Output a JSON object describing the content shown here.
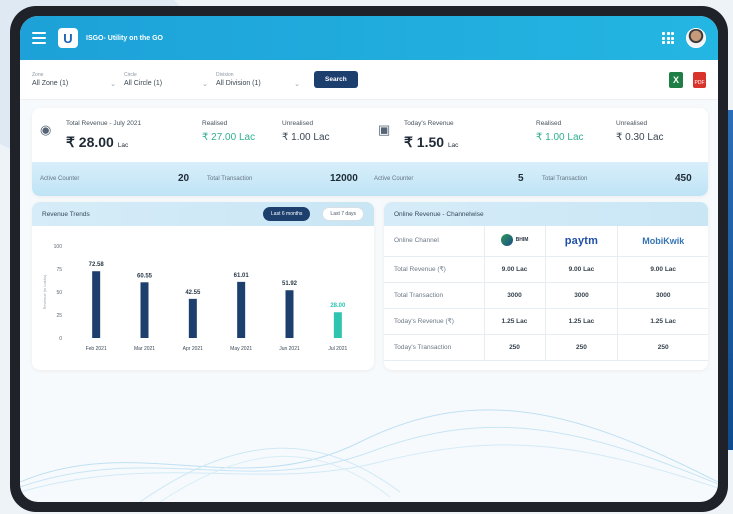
{
  "app": {
    "title": "ISGO- Utility on the GO",
    "logo_letter": "U"
  },
  "filters": [
    {
      "label": "Zone",
      "value": "All Zone (1)"
    },
    {
      "label": "Circle",
      "value": "All Circle (1)"
    },
    {
      "label": "Division",
      "value": "All Division (1)"
    }
  ],
  "search_label": "Search",
  "export": {
    "xls": "X",
    "pdf": "PDF"
  },
  "summary": {
    "left": {
      "title": "Total Revenue - July 2021",
      "amount": "₹ 28.00",
      "unit": "Lac",
      "realised_label": "Realised",
      "realised": "₹ 27.00 Lac",
      "unrealised_label": "Unrealised",
      "unrealised": "₹ 1.00 Lac",
      "counter_label": "Active Counter",
      "counter": "20",
      "txn_label": "Total Transaction",
      "txn": "12000"
    },
    "right": {
      "title": "Today's Revenue",
      "amount": "₹ 1.50",
      "unit": "Lac",
      "realised_label": "Realised",
      "realised": "₹ 1.00 Lac",
      "unrealised_label": "Unrealised",
      "unrealised": "₹ 0.30 Lac",
      "counter_label": "Active Counter",
      "counter": "5",
      "txn_label": "Total Transaction",
      "txn": "450"
    }
  },
  "trends": {
    "title": "Revenue Trends",
    "toggle_active": "Last 6 months",
    "toggle_other": "Last 7 days"
  },
  "chart_data": {
    "type": "bar",
    "categories": [
      "Feb 2021",
      "Mar 2021",
      "Apr 2021",
      "May 2021",
      "Jun 2021",
      "Jul 2021"
    ],
    "values": [
      72.58,
      60.55,
      42.55,
      61.01,
      51.92,
      28.0
    ],
    "value_labels": [
      "72.58",
      "60.55",
      "42.55",
      "61.01",
      "51.92",
      "28.00"
    ],
    "ylabel": "Revenue (in Lakhs)",
    "yticks": [
      0,
      25,
      50,
      75,
      100
    ],
    "ylim": [
      0,
      100
    ],
    "colors": {
      "bar": "#1d3f6e",
      "highlight": "#2ec4b0"
    }
  },
  "online": {
    "title": "Online Revenue - Channelwise",
    "header_label": "Online Channel",
    "channels": [
      "BHIM",
      "paytm",
      "MobiKwik"
    ],
    "rows": [
      {
        "label": "Total Revenue (₹)",
        "values": [
          "9.00 Lac",
          "9.00 Lac",
          "9.00 Lac"
        ]
      },
      {
        "label": "Total Transaction",
        "values": [
          "3000",
          "3000",
          "3000"
        ]
      },
      {
        "label": "Today's Revenue (₹)",
        "values": [
          "1.25 Lac",
          "1.25 Lac",
          "1.25 Lac"
        ]
      },
      {
        "label": "Today's Transaction",
        "values": [
          "250",
          "250",
          "250"
        ]
      }
    ]
  }
}
